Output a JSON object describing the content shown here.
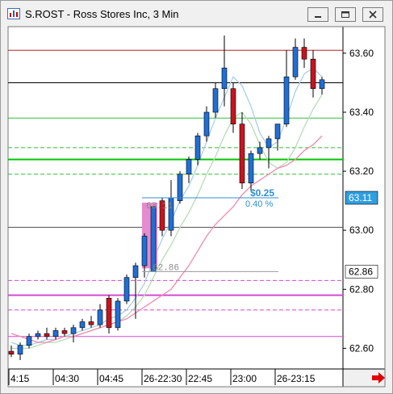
{
  "window": {
    "title": "S.ROST - Ross Stores Inc, 3 Min"
  },
  "chart_data": {
    "type": "candlestick",
    "symbol": "S.ROST",
    "interval": "3 Min",
    "ylim": [
      62.53,
      63.69
    ],
    "y_ticks": [
      {
        "value": 63.6,
        "label": "63.60"
      },
      {
        "value": 63.4,
        "label": "63.40"
      },
      {
        "value": 63.2,
        "label": "63.20"
      },
      {
        "value": 63.0,
        "label": "63.00"
      },
      {
        "value": 62.8,
        "label": "62.80"
      },
      {
        "value": 62.6,
        "label": "62.60"
      }
    ],
    "x_ticks": [
      {
        "index": 0,
        "label": "4:15"
      },
      {
        "index": 5,
        "label": "04:30"
      },
      {
        "index": 10,
        "label": "04:45"
      },
      {
        "index": 15,
        "label": "26-22:30"
      },
      {
        "index": 20,
        "label": "22:45"
      },
      {
        "index": 25,
        "label": "23:00"
      },
      {
        "index": 30,
        "label": "26-23:15"
      }
    ],
    "price_tags": [
      {
        "value": 63.11,
        "label": "63.11",
        "bg": "#2f9ee0",
        "fg": "#ffffff"
      },
      {
        "value": 62.86,
        "label": "62.86",
        "bg": "#ffffff",
        "fg": "#000000"
      }
    ],
    "candles": [
      {
        "o": 62.59,
        "h": 62.61,
        "l": 62.57,
        "c": 62.58
      },
      {
        "o": 62.58,
        "h": 62.62,
        "l": 62.56,
        "c": 62.61
      },
      {
        "o": 62.61,
        "h": 62.65,
        "l": 62.6,
        "c": 62.64
      },
      {
        "o": 62.64,
        "h": 62.66,
        "l": 62.63,
        "c": 62.65
      },
      {
        "o": 62.65,
        "h": 62.67,
        "l": 62.63,
        "c": 62.64
      },
      {
        "o": 62.64,
        "h": 62.67,
        "l": 62.63,
        "c": 62.66
      },
      {
        "o": 62.66,
        "h": 62.67,
        "l": 62.64,
        "c": 62.65
      },
      {
        "o": 62.65,
        "h": 62.68,
        "l": 62.62,
        "c": 62.67
      },
      {
        "o": 62.67,
        "h": 62.7,
        "l": 62.66,
        "c": 62.69
      },
      {
        "o": 62.69,
        "h": 62.71,
        "l": 62.67,
        "c": 62.68
      },
      {
        "o": 62.68,
        "h": 62.75,
        "l": 62.67,
        "c": 62.73
      },
      {
        "o": 62.77,
        "h": 62.78,
        "l": 62.65,
        "c": 62.67
      },
      {
        "o": 62.67,
        "h": 62.77,
        "l": 62.66,
        "c": 62.76
      },
      {
        "o": 62.76,
        "h": 62.85,
        "l": 62.75,
        "c": 62.84
      },
      {
        "o": 62.84,
        "h": 62.89,
        "l": 62.7,
        "c": 62.88
      },
      {
        "o": 62.88,
        "h": 62.99,
        "l": 62.84,
        "c": 62.98
      },
      {
        "o": 62.86,
        "h": 63.08,
        "l": 62.86,
        "c": 63.08
      },
      {
        "o": 63.1,
        "h": 63.11,
        "l": 62.98,
        "c": 63.0
      },
      {
        "o": 63.0,
        "h": 63.17,
        "l": 62.98,
        "c": 63.11
      },
      {
        "o": 63.1,
        "h": 63.2,
        "l": 63.09,
        "c": 63.19
      },
      {
        "o": 63.19,
        "h": 63.25,
        "l": 63.16,
        "c": 63.24
      },
      {
        "o": 63.24,
        "h": 63.33,
        "l": 63.22,
        "c": 63.32
      },
      {
        "o": 63.32,
        "h": 63.42,
        "l": 63.3,
        "c": 63.4
      },
      {
        "o": 63.4,
        "h": 63.5,
        "l": 63.38,
        "c": 63.48
      },
      {
        "o": 63.48,
        "h": 63.66,
        "l": 63.42,
        "c": 63.55
      },
      {
        "o": 63.48,
        "h": 63.5,
        "l": 63.33,
        "c": 63.36
      },
      {
        "o": 63.36,
        "h": 63.4,
        "l": 63.14,
        "c": 63.16
      },
      {
        "o": 63.16,
        "h": 63.27,
        "l": 63.13,
        "c": 63.26
      },
      {
        "o": 63.26,
        "h": 63.3,
        "l": 63.24,
        "c": 63.28
      },
      {
        "o": 63.28,
        "h": 63.32,
        "l": 63.21,
        "c": 63.31
      },
      {
        "o": 63.31,
        "h": 63.36,
        "l": 63.27,
        "c": 63.36
      },
      {
        "o": 63.36,
        "h": 63.61,
        "l": 63.35,
        "c": 63.52
      },
      {
        "o": 63.52,
        "h": 63.65,
        "l": 63.51,
        "c": 63.62
      },
      {
        "o": 63.62,
        "h": 63.65,
        "l": 63.55,
        "c": 63.58
      },
      {
        "o": 63.58,
        "h": 63.61,
        "l": 63.45,
        "c": 63.48
      },
      {
        "o": 63.48,
        "h": 63.52,
        "l": 63.46,
        "c": 63.51
      }
    ],
    "horizontal_lines": [
      {
        "value": 63.61,
        "color": "#b0272b",
        "width": 1,
        "dash": false
      },
      {
        "value": 63.5,
        "color": "#000000",
        "width": 1,
        "dash": false
      },
      {
        "value": 63.38,
        "color": "#2fbf3f",
        "width": 1,
        "dash": false
      },
      {
        "value": 63.28,
        "color": "#2fbf3f",
        "width": 1,
        "dash": true
      },
      {
        "value": 63.24,
        "color": "#00c400",
        "width": 2,
        "dash": false
      },
      {
        "value": 63.19,
        "color": "#2fbf3f",
        "width": 1,
        "dash": true
      },
      {
        "value": 63.01,
        "color": "#555555",
        "width": 1,
        "dash": false
      },
      {
        "value": 62.83,
        "color": "#d34ad3",
        "width": 1,
        "dash": true
      },
      {
        "value": 62.78,
        "color": "#d34ad3",
        "width": 2,
        "dash": false
      },
      {
        "value": 62.73,
        "color": "#d34ad3",
        "width": 1,
        "dash": true
      },
      {
        "value": 62.64,
        "color": "#d34ad3",
        "width": 1,
        "dash": false
      }
    ],
    "moving_averages": [
      {
        "color": "#a8cfe8",
        "values": [
          62.62,
          62.61,
          62.61,
          62.62,
          62.63,
          62.63,
          62.64,
          62.65,
          62.66,
          62.67,
          62.68,
          62.7,
          62.71,
          62.73,
          62.77,
          62.82,
          62.9,
          62.97,
          63.03,
          63.1,
          63.15,
          63.22,
          63.3,
          63.38,
          63.45,
          63.52,
          63.49,
          63.42,
          63.33,
          63.28,
          63.3,
          63.38,
          63.47,
          63.53,
          63.55,
          63.52
        ]
      },
      {
        "color": "#b6dcb6",
        "values": [
          62.6,
          62.6,
          62.6,
          62.61,
          62.62,
          62.62,
          62.63,
          62.64,
          62.65,
          62.66,
          62.67,
          62.68,
          62.69,
          62.71,
          62.74,
          62.78,
          62.84,
          62.9,
          62.95,
          63.01,
          63.06,
          63.12,
          63.19,
          63.25,
          63.32,
          63.38,
          63.4,
          63.36,
          63.29,
          63.23,
          63.21,
          63.23,
          63.28,
          63.35,
          63.41,
          63.46
        ]
      },
      {
        "color": "#f08ab0",
        "values": [
          62.65,
          62.64,
          62.63,
          62.62,
          62.62,
          62.63,
          62.64,
          62.64,
          62.65,
          62.66,
          62.67,
          62.68,
          62.69,
          62.7,
          62.72,
          62.74,
          62.76,
          62.78,
          62.8,
          62.84,
          62.88,
          62.93,
          62.98,
          63.02,
          63.05,
          63.08,
          63.12,
          63.15,
          63.17,
          63.19,
          63.21,
          63.22,
          63.24,
          63.27,
          63.29,
          63.32
        ]
      }
    ],
    "annotations": {
      "change_value": "$0.25",
      "change_percent": "0.40 %",
      "range_low_label": "62.86",
      "range_high_label": "63.11",
      "target_line_value": 63.11,
      "low_line_value": 62.86,
      "highlight": {
        "from_index": 15,
        "to_index": 16
      }
    }
  }
}
